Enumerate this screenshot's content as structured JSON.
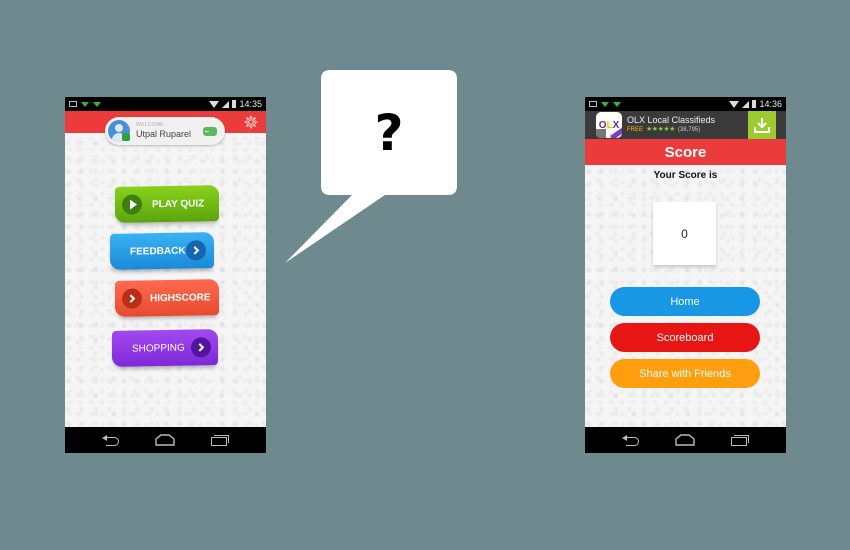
{
  "left_phone": {
    "status_bar": {
      "time": "14:35"
    },
    "profile": {
      "welcome_label": "WELCOME",
      "user_name": "Utpal Ruparel"
    },
    "menu": [
      {
        "label": "PLAY QUIZ",
        "color": "#6ebd14",
        "icon": "play-icon"
      },
      {
        "label": "FEEDBACK",
        "color": "#2aa0e8",
        "icon": "chevron-right-icon"
      },
      {
        "label": "HIGHSCORE",
        "color": "#f45a3e",
        "icon": "chevron-right-icon"
      },
      {
        "label": "SHOPPING",
        "color": "#9038e6",
        "icon": "chevron-right-icon"
      }
    ],
    "header_color": "#ec3b3b"
  },
  "speech_bubble": {
    "text": "?"
  },
  "right_phone": {
    "status_bar": {
      "time": "14:36"
    },
    "ad": {
      "title": "OLX Local Classifieds",
      "price": "FREE",
      "stars": "★★★★★",
      "rating_count": "(38,795)",
      "logo_text": {
        "o": "O",
        "l": "L",
        "x": "X"
      }
    },
    "header_title": "Score",
    "score_caption": "Your Score is",
    "score_value": "0",
    "buttons": [
      {
        "label": "Home",
        "color": "#1797e4"
      },
      {
        "label": "Scoreboard",
        "color": "#e81515"
      },
      {
        "label": "Share with Friends",
        "color": "#ff9e0f"
      }
    ]
  },
  "colors": {
    "background": "#6e8a8f",
    "accent_red": "#ec3b3b"
  }
}
